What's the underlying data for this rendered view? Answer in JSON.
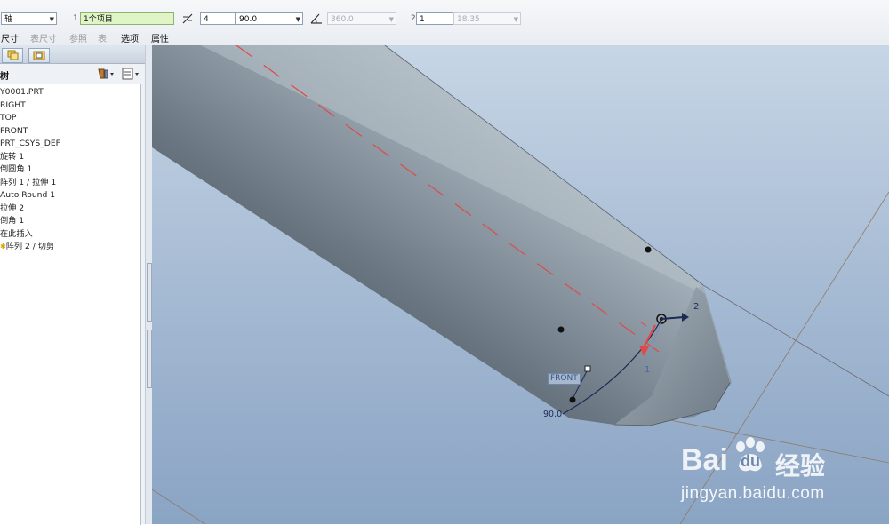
{
  "toolbar": {
    "type_value": "轴",
    "ref_num_1": "1",
    "ref_value": "1个项目",
    "offset_value": "4",
    "angle_value": "90.0",
    "disabled_angle": "360.0",
    "ref_num_2": "2",
    "second_value": "1",
    "disabled_value2": "18.35",
    "menu": [
      "尺寸",
      "表尺寸",
      "参照",
      "表",
      "选项",
      "属性"
    ]
  },
  "panel": {
    "title": "树"
  },
  "tree": {
    "items": [
      "Y0001.PRT",
      "RIGHT",
      "TOP",
      "FRONT",
      "PRT_CSYS_DEF",
      "旋转 1",
      "倒圆角 1",
      "阵列 1 / 拉伸 1",
      "Auto Round 1",
      "拉伸 2",
      "倒角 1",
      "在此插入",
      "阵列 2 / 切剪"
    ]
  },
  "viewport": {
    "front_label": "FRONT",
    "angle_label": "90.0",
    "axis_label_1": "1",
    "axis_label_2": "2"
  },
  "watermark": {
    "brand": "Bai",
    "brand2": "du",
    "cn": "经验",
    "url": "jingyan.baidu.com"
  },
  "colors": {
    "accent_red": "#e34848",
    "highlight_green": "#dff5c8",
    "axis_blue": "#1e2a55"
  }
}
